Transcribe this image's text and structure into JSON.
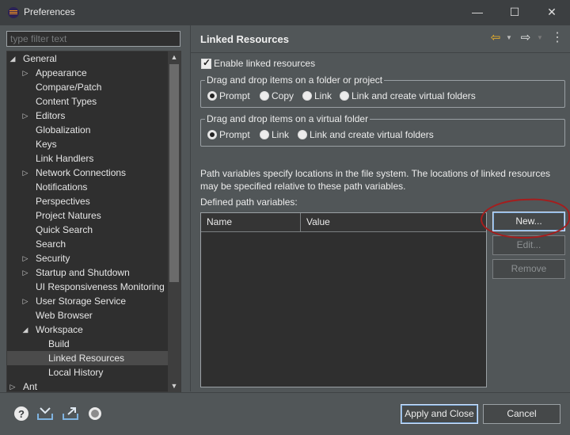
{
  "window": {
    "title": "Preferences"
  },
  "window_controls": {
    "minimize": "—",
    "maximize": "☐",
    "close": "✕"
  },
  "filter": {
    "placeholder": "type filter text",
    "value": ""
  },
  "tree": {
    "items": [
      {
        "label": "General",
        "expanded": true
      },
      {
        "label": "Appearance",
        "expandable": true
      },
      {
        "label": "Compare/Patch"
      },
      {
        "label": "Content Types"
      },
      {
        "label": "Editors",
        "expandable": true
      },
      {
        "label": "Globalization"
      },
      {
        "label": "Keys"
      },
      {
        "label": "Link Handlers"
      },
      {
        "label": "Network Connections",
        "expandable": true
      },
      {
        "label": "Notifications"
      },
      {
        "label": "Perspectives"
      },
      {
        "label": "Project Natures"
      },
      {
        "label": "Quick Search"
      },
      {
        "label": "Search"
      },
      {
        "label": "Security",
        "expandable": true
      },
      {
        "label": "Startup and Shutdown",
        "expandable": true
      },
      {
        "label": "UI Responsiveness Monitoring"
      },
      {
        "label": "User Storage Service",
        "expandable": true
      },
      {
        "label": "Web Browser"
      },
      {
        "label": "Workspace",
        "expanded": true
      },
      {
        "label": "Build"
      },
      {
        "label": "Linked Resources",
        "selected": true
      },
      {
        "label": "Local History"
      },
      {
        "label": "Ant",
        "expandable": true
      }
    ]
  },
  "page": {
    "title": "Linked Resources"
  },
  "enable_linked": {
    "label": "Enable linked resources",
    "checked": true
  },
  "group_folder": {
    "legend": "Drag and drop items on a folder or project",
    "options": [
      "Prompt",
      "Copy",
      "Link",
      "Link and create virtual folders"
    ],
    "selected": "Prompt"
  },
  "group_virtual": {
    "legend": "Drag and drop items on a virtual folder",
    "options": [
      "Prompt",
      "Link",
      "Link and create virtual folders"
    ],
    "selected": "Prompt"
  },
  "path_info": {
    "line1": "Path variables specify locations in the file system. The locations of linked resources",
    "line2": "may be specified relative to these path variables."
  },
  "defined_label": "Defined path variables:",
  "table": {
    "columns": [
      "Name",
      "Value"
    ],
    "rows": []
  },
  "buttons": {
    "new": "New...",
    "edit": "Edit...",
    "remove": "Remove",
    "apply_close": "Apply and Close",
    "cancel": "Cancel"
  },
  "bottom_icons": [
    "help-icon",
    "import-icon",
    "export-icon",
    "oomph-icon"
  ],
  "colors": {
    "annotation": "#a51d1d",
    "nav_back": "#f0b429",
    "background": "#515658",
    "panel": "#2f2f2f"
  }
}
